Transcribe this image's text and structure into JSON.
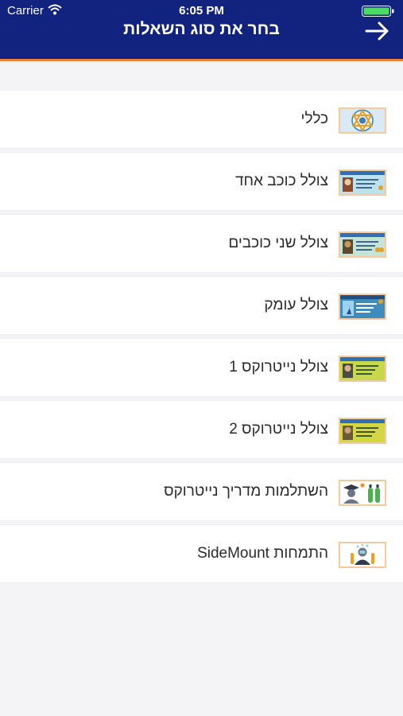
{
  "status": {
    "carrier": "Carrier",
    "time": "6:05 PM"
  },
  "header": {
    "title": "בחר את סוג השאלות"
  },
  "items": [
    {
      "label": "כללי",
      "icon": "star-of-david-logo-icon"
    },
    {
      "label": "צולל כוכב אחד",
      "icon": "diver-card-one-star-icon"
    },
    {
      "label": "צולל שני כוכבים",
      "icon": "diver-card-two-star-icon"
    },
    {
      "label": "צולל עומק",
      "icon": "diver-card-deep-icon"
    },
    {
      "label": "צולל נייטרוקס 1",
      "icon": "diver-card-nitrox1-icon"
    },
    {
      "label": "צולל נייטרוקס 2",
      "icon": "diver-card-nitrox2-icon"
    },
    {
      "label": "השתלמות מדריך נייטרוקס",
      "icon": "nitrox-instructor-icon"
    },
    {
      "label": "התמחות SideMount",
      "icon": "sidemount-diver-icon"
    }
  ],
  "colors": {
    "header": "#11237f",
    "accent_line": "#e2873a",
    "icon_border": "#f2cba0"
  }
}
